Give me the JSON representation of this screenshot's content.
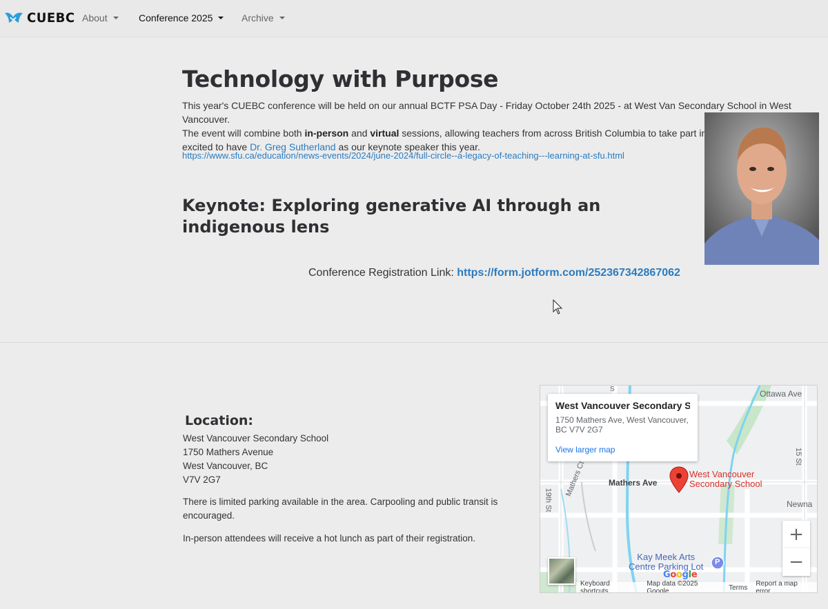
{
  "nav": {
    "brand": "CUEBC",
    "items": [
      {
        "label": "About",
        "active": false
      },
      {
        "label": "Conference 2025",
        "active": true
      },
      {
        "label": "Archive",
        "active": false
      }
    ]
  },
  "hero": {
    "title": "Technology with Purpose",
    "para_line1": "This year's CUEBC conference will be held on our annual BCTF PSA Day - Friday October 24th 2025 - at West Van Secondary School in West Vancouver.",
    "para_pre1": "The event will combine both ",
    "para_bold1": "in-person",
    "para_mid": " and ",
    "para_bold2": "virtual",
    "para_post": " sessions, allowing teachers from across British Columbia to take part in learning together. We are excited to have ",
    "speaker_link": "Dr. Greg Sutherland",
    "para_end": " as our keynote speaker this year.",
    "sfu_link": "https://www.sfu.ca/education/news-events/2024/june-2024/full-circle--a-legacy-of-teaching---learning-at-sfu.html",
    "keynote": "Keynote: Exploring generative AI through an indigenous lens",
    "reg_label": "Conference Registration Link: ",
    "reg_link": "https://form.jotform.com/252367342867062"
  },
  "location": {
    "title": "Location:",
    "address": [
      "West Vancouver Secondary School",
      "1750 Mathers Avenue",
      "West Vancouver, BC",
      "V7V 2G7"
    ],
    "parking_note": "There is limited parking available in the area. Carpooling and public transit is encouraged.",
    "lunch_note": "In-person attendees will receive a hot lunch as part of their registration."
  },
  "map": {
    "info_name": "West Vancouver Secondary S...",
    "info_addr": "1750 Mathers Ave, West Vancouver, BC V7V 2G7",
    "view_larger": "View larger map",
    "labels": {
      "ottawa": "Ottawa Ave",
      "mathers": "Mathers Ave",
      "mathers_ct": "Mathers Ct",
      "nineteenth": "19th St",
      "fifteenth": "15 St",
      "newna": "Newna",
      "s_letter": "S",
      "marker_line1": "West Vancouver",
      "marker_line2": "Secondary School",
      "kay_line1": "Kay Meek Arts",
      "kay_line2": "Centre Parking Lot",
      "parking_badge": "P"
    },
    "zoom_in": "+",
    "zoom_out": "−",
    "footer": [
      "Keyboard shortcuts",
      "Map data ©2025 Google",
      "Terms",
      "Report a map error"
    ],
    "google": "Google"
  },
  "colors": {
    "link": "#2a7bbf",
    "marker": "#ea4335",
    "map_blue": "#1a73e8"
  }
}
